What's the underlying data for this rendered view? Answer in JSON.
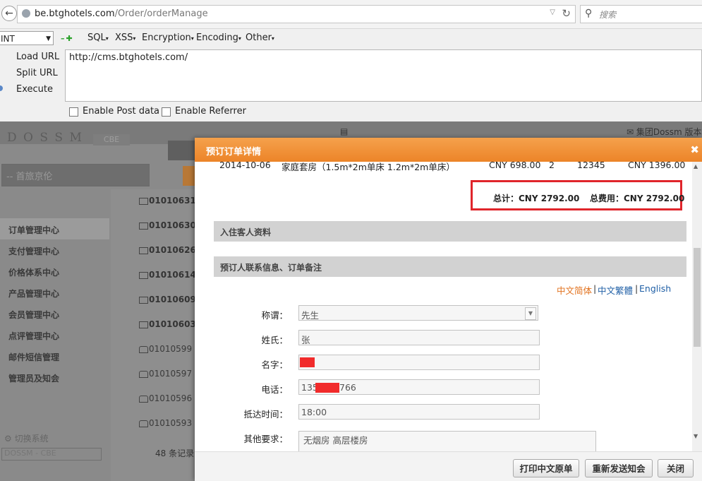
{
  "browser": {
    "url_domain": "be.btghotels.com",
    "url_path": "/Order/orderManage",
    "search_placeholder": "搜索"
  },
  "hackbar": {
    "select_value": "INT",
    "menus": [
      "SQL",
      "XSS",
      "Encryption",
      "Encoding",
      "Other"
    ],
    "commands": [
      "Load URL",
      "Split URL",
      "Execute"
    ],
    "url_value": "http://cms.btghotels.com/",
    "enable_post": "Enable Post data",
    "enable_referrer": "Enable Referrer"
  },
  "app": {
    "logo": "D O S S M",
    "logo_badge": "CBE",
    "hotel_select": "-- 首旅京伦",
    "top_right": "集团Dossm 版本",
    "nav": [
      "订单管理中心",
      "支付管理中心",
      "价格体系中心",
      "产品管理中心",
      "会员管理中心",
      "点评管理中心",
      "邮件短信管理",
      "管理员及知会"
    ],
    "switch_system": "切换系统",
    "system_select": "DOSSM - CBE",
    "orders": [
      "01010631",
      "01010630",
      "01010626",
      "01010614",
      "01010609",
      "01010603",
      "01010599",
      "01010597",
      "01010596",
      "01010593"
    ],
    "record_count": "48 条记录"
  },
  "modal": {
    "title": "预订订单详情",
    "row": {
      "date": "2014-10-06",
      "room": "家庭套房（1.5m*2m单床 1.2m*2m单床）",
      "price": "CNY 698.00",
      "qty": "2",
      "code": "12345",
      "total": "CNY 1396.00"
    },
    "subtotal": "总计：CNY 2792.00",
    "total_fee": "总费用：CNY 2792.00",
    "section_guest": "入住客人资料",
    "section_contact": "预订人联系信息、订单备注",
    "lang": {
      "simplified": "中文简体",
      "traditional": "中文繁體",
      "english": "English",
      "sep": "|"
    },
    "form": {
      "title_label": "称谓：",
      "title_value": "先生",
      "surname_label": "姓氏：",
      "surname_value": "张",
      "name_label": "名字：",
      "name_value": "",
      "phone_label": "电话：",
      "phone_prefix": "135",
      "phone_suffix": "766",
      "arrival_label": "抵达时间：",
      "arrival_value": "18:00",
      "other_label": "其他要求：",
      "other_value": "无烟房 高层楼房"
    },
    "buttons": {
      "print": "打印中文原单",
      "resend": "重新发送知会",
      "close": "关闭"
    }
  }
}
